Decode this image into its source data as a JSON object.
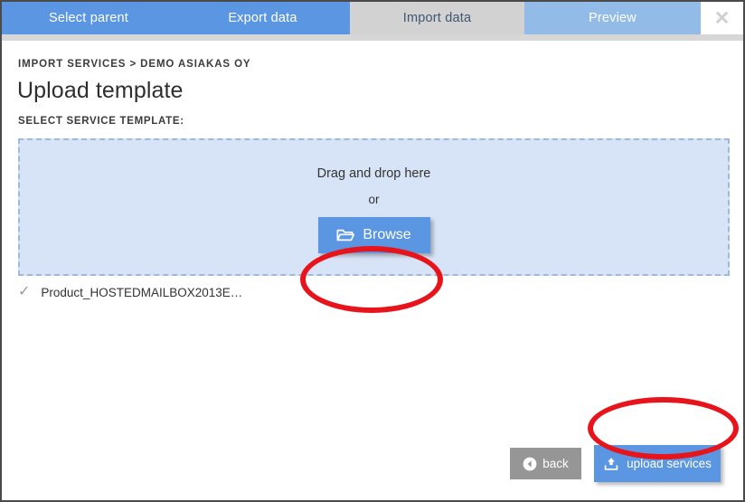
{
  "window": {
    "close_label": "✕"
  },
  "tabs": [
    {
      "label": "Select parent",
      "state": "inactive"
    },
    {
      "label": "Export data",
      "state": "inactive"
    },
    {
      "label": "Import data",
      "state": "active"
    },
    {
      "label": "Preview",
      "state": "upcoming"
    }
  ],
  "page": {
    "breadcrumb": "IMPORT SERVICES > DEMO ASIAKAS OY",
    "title": "Upload template",
    "field_label": "SELECT SERVICE TEMPLATE:"
  },
  "dropzone": {
    "drag_text": "Drag and drop here",
    "or_text": "or",
    "browse_label": "Browse",
    "browse_icon": "folder-open-icon"
  },
  "uploaded_file": {
    "check_icon": "✓",
    "name": "Product_HOSTEDMAILBOX2013E…"
  },
  "footer": {
    "back_label": "back",
    "back_icon": "arrow-left-circle-icon",
    "upload_label": "upload services",
    "upload_icon": "upload-icon"
  },
  "annotations": [
    {
      "name": "browse-highlight",
      "shape": "ellipse",
      "color": "#e8141b"
    },
    {
      "name": "upload-highlight",
      "shape": "ellipse",
      "color": "#e8141b"
    }
  ],
  "colors": {
    "tab_active": "#d2d2d2",
    "tab_inactive": "#5b96e2",
    "tab_upcoming": "#92bbe8",
    "primary_button": "#5b96e2",
    "secondary_button": "#969696",
    "dropzone_bg": "#d7e3f6",
    "dropzone_border": "#9eb9da",
    "annotation": "#e8141b"
  }
}
